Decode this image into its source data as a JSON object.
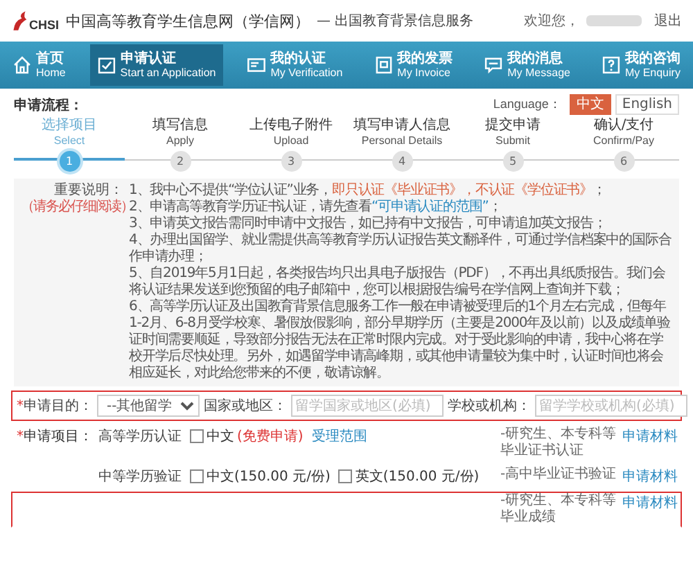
{
  "header": {
    "logo_text": "CHSI",
    "site_title": "中国高等教育学生信息网（学信网）",
    "subtitle": "— 出国教育背景信息服务",
    "welcome": "欢迎您，",
    "logout": "退出"
  },
  "nav": [
    {
      "zh": "首页",
      "en": "Home",
      "selected": false
    },
    {
      "zh": "申请认证",
      "en": "Start an Application",
      "selected": true
    },
    {
      "zh": "我的认证",
      "en": "My Verification",
      "selected": false
    },
    {
      "zh": "我的发票",
      "en": "My Invoice",
      "selected": false
    },
    {
      "zh": "我的消息",
      "en": "My Message",
      "selected": false
    },
    {
      "zh": "我的咨询",
      "en": "My Enquiry",
      "selected": false
    }
  ],
  "process": {
    "title": "申请流程：",
    "language_label": "Language：",
    "languages": [
      {
        "label": "中文",
        "selected": true
      },
      {
        "label": "English",
        "selected": false
      }
    ],
    "steps": [
      {
        "zh": "选择项目",
        "en": "Select",
        "number": "1",
        "selected": true
      },
      {
        "zh": "填写信息",
        "en": "Apply",
        "number": "2",
        "selected": false
      },
      {
        "zh": "上传电子附件",
        "en": "Upload",
        "number": "3",
        "selected": false
      },
      {
        "zh": "填写申请人信息",
        "en": "Personal Details",
        "number": "4",
        "selected": false
      },
      {
        "zh": "提交申请",
        "en": "Submit",
        "number": "5",
        "selected": false
      },
      {
        "zh": "确认/支付",
        "en": "Confirm/Pay",
        "number": "6",
        "selected": false
      }
    ]
  },
  "notes": {
    "label": "重要说明：",
    "hint": "（请务必仔细阅读）",
    "items": [
      [
        {
          "kind": "plain",
          "text": "1、我中心不提供“学位认证”业务，"
        },
        {
          "kind": "warn",
          "text": "即只认证《毕业证书》，不认证《学位证书》"
        },
        {
          "kind": "plain",
          "text": "；"
        }
      ],
      [
        {
          "kind": "plain",
          "text": "2、申请高等教育学历证书认证，请先查看"
        },
        {
          "kind": "link",
          "text": "“可申请认证的范围”"
        },
        {
          "kind": "plain",
          "text": "；"
        }
      ],
      [
        {
          "kind": "plain",
          "text": "3、申请英文报告需同时申请中文报告，如已持有中文报告，可申请追加英文报告；"
        }
      ],
      [
        {
          "kind": "plain",
          "text": "4、办理出国留学、就业需提供高等教育学历认证报告英文翻译件，可通过学信档案中的国际合作申请办理；"
        }
      ],
      [
        {
          "kind": "plain",
          "text": "5、自2019年5月1日起，各类报告均只出具电子版报告（PDF），不再出具纸质报告。我们会将认证结果发送到您预留的电子邮箱中，您可以根据报告编号在学信网上查询并下载；"
        }
      ],
      [
        {
          "kind": "plain",
          "text": "6、高等学历认证及出国教育背景信息服务工作一般在申请被受理后的1个月左右完成，但每年1-2月、6-8月受学校寒、暑假放假影响，部分早期学历（主要是2000年及以前）以及成绩单验证时间需要顺延，导致部分报告无法在正常时限内完成。对于受此影响的申请，我中心将在学校开学后尽快处理。另外，如遇留学申请高峰期，或其他申请量较为集中时，认证时间也将会相应延长，对此给您带来的不便，敬请谅解。"
        }
      ]
    ]
  },
  "purpose": {
    "required_mark": "*",
    "label": "申请目的：",
    "value": "--其他留学",
    "country_label": "国家或地区：",
    "country_placeholder": "留学国家或地区(必填)",
    "school_label": "学校或机构：",
    "school_placeholder": "留学学校或机构(必填)"
  },
  "items": {
    "required_mark": "*",
    "label": "申请项目：",
    "rows": [
      {
        "highlighted": false,
        "name": "高等学历认证",
        "options": [
          {
            "label": "中文",
            "note": "(免费申请)",
            "checked": false
          }
        ],
        "link": "受理范围",
        "desc": "-研究生、本专科等毕业证书认证",
        "materials": "申请材料"
      },
      {
        "highlighted": false,
        "name": "中等学历验证",
        "options": [
          {
            "label": "中文(150.00 元/份)",
            "checked": false
          },
          {
            "label": "英文(150.00 元/份)",
            "checked": false
          }
        ],
        "desc": "-高中毕业证书验证",
        "materials": "申请材料"
      },
      {
        "highlighted": true,
        "desc": "-研究生、本专科等毕业成绩",
        "materials": "申请材料"
      }
    ]
  }
}
